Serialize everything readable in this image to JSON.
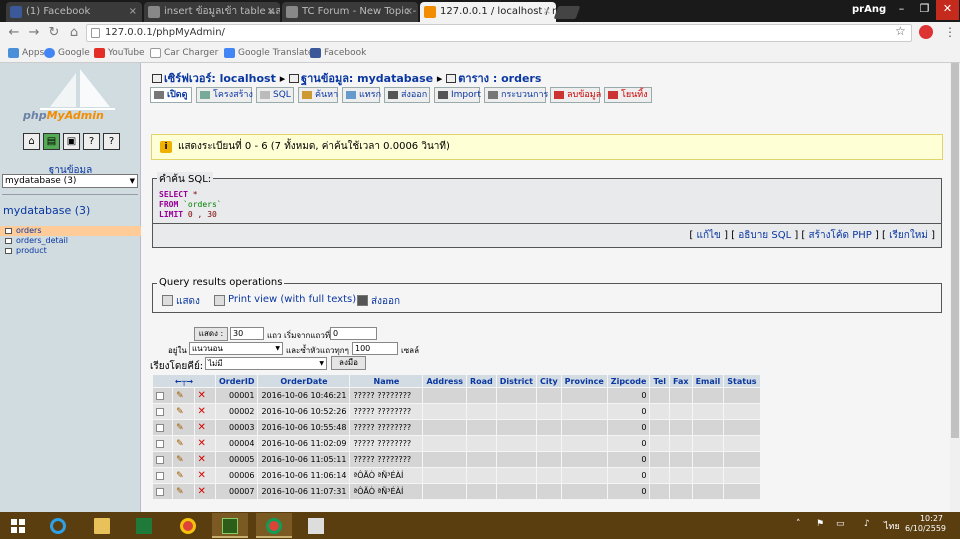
{
  "browser": {
    "tabs": [
      {
        "title": "(1) Facebook",
        "color": "#3b5998"
      },
      {
        "title": "insert ข้อมูลเข้า table และ",
        "color": "#888888"
      },
      {
        "title": "TC Forum - New Topic -",
        "color": "#888888"
      },
      {
        "title": "127.0.0.1 / localhost / my",
        "color": "#f28c00"
      }
    ],
    "profile": "prAng",
    "address": "127.0.0.1/phpMyAdmin/",
    "bookmarks": [
      {
        "label": "Apps",
        "color": "#4a90d9"
      },
      {
        "label": "Google",
        "color": "#4285f4"
      },
      {
        "label": "YouTube",
        "color": "#e52d27"
      },
      {
        "label": "Car Charger",
        "color": "#777777"
      },
      {
        "label": "Google Translate",
        "color": "#4285f4"
      },
      {
        "label": "Facebook",
        "color": "#3b5998"
      }
    ]
  },
  "sidebar": {
    "logo_a": "php",
    "logo_b": "MyAdmin",
    "db_label": "ฐานข้อมูล",
    "db_select": "mydatabase (3)",
    "db_title": "mydatabase (3)",
    "tables": [
      "orders",
      "orders_detail",
      "product"
    ]
  },
  "breadcrumb": {
    "server_label": "เซิร์ฟเวอร์: localhost",
    "db_label": "ฐานข้อมูล: mydatabase",
    "table_label": "ตาราง : orders"
  },
  "tabs": [
    "เปิดดู",
    "โครงสร้าง",
    "SQL",
    "ค้นหา",
    "แทรก",
    "ส่งออก",
    "Import",
    "กระบวนการ",
    "ลบข้อมูล",
    "โยนทิ้ง"
  ],
  "notice": "แสดงระเบียนที่ 0 - 6 (7 ทั้งหมด, ค่าค้นใช้เวลา 0.0006 วินาที)",
  "sql": {
    "legend": "คำค้น SQL:",
    "select_kw": "SELECT",
    "select_val": "*",
    "from_kw": "FROM",
    "from_val": "`orders`",
    "limit_kw": "LIMIT",
    "limit_val": "0 , 30"
  },
  "sql_links": {
    "edit": "แก้ไข",
    "explain": "อธิบาย SQL",
    "php": "สร้างโค้ด PHP",
    "refresh": "เรียกใหม่"
  },
  "query_ops": {
    "legend": "Query results operations",
    "show": "แสดง",
    "print": "Print view (with full texts)",
    "export": "ส่งออก"
  },
  "nav": {
    "show_btn": "แสดง :",
    "rows": "30",
    "rows_label": "แถว เริ่มจากแถวที่",
    "start": "0",
    "in_label": "อยู่ใน",
    "mode": "แนวนอน",
    "repeat_label": "และซ้ำหัวแถวทุกๆ",
    "repeat": "100",
    "cells_label": "เซลล์",
    "sort_label": "เรียงโดยคีย์:",
    "sort_value": "ไม่มี",
    "go": "ลงมือ"
  },
  "grid": {
    "columns": [
      "OrderID",
      "OrderDate",
      "Name",
      "Address",
      "Road",
      "District",
      "City",
      "Province",
      "Zipcode",
      "Tel",
      "Fax",
      "Email",
      "Status"
    ],
    "rows": [
      {
        "id": "00001",
        "date": "2016-10-06 10:46:21",
        "name": "????? ????????",
        "zip": "0"
      },
      {
        "id": "00002",
        "date": "2016-10-06 10:52:26",
        "name": "????? ????????",
        "zip": "0"
      },
      {
        "id": "00003",
        "date": "2016-10-06 10:55:48",
        "name": "????? ????????",
        "zip": "0"
      },
      {
        "id": "00004",
        "date": "2016-10-06 11:02:09",
        "name": "????? ????????",
        "zip": "0"
      },
      {
        "id": "00005",
        "date": "2016-10-06 11:05:11",
        "name": "????? ????????",
        "zip": "0"
      },
      {
        "id": "00006",
        "date": "2016-10-06 11:06:14",
        "name": "ªÔÃÒ ªÑ³ÉÀÍ",
        "zip": "0"
      },
      {
        "id": "00007",
        "date": "2016-10-06 11:07:31",
        "name": "ªÔÃÒ ªÑ³ÉÀÍ",
        "zip": "0"
      }
    ]
  },
  "taskbar": {
    "lang": "ไทย",
    "time": "10:27",
    "date": "6/10/2559"
  }
}
